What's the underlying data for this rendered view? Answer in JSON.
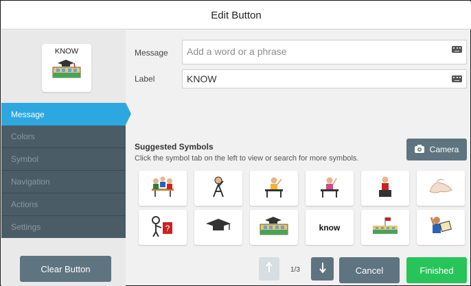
{
  "window": {
    "title": "Edit Button"
  },
  "preview": {
    "label": "KNOW",
    "icon": "graduation-school-icon"
  },
  "sidebar": {
    "items": [
      {
        "label": "Message",
        "active": true
      },
      {
        "label": "Colors",
        "active": false
      },
      {
        "label": "Symbol",
        "active": false
      },
      {
        "label": "Navigation",
        "active": false
      },
      {
        "label": "Actions",
        "active": false
      },
      {
        "label": "Settings",
        "active": false
      }
    ],
    "clear_label": "Clear Button"
  },
  "form": {
    "message_label": "Message",
    "message_value": "",
    "message_placeholder": "Add a word or a phrase",
    "label_label": "Label",
    "label_value": "KNOW"
  },
  "suggested": {
    "title": "Suggested Symbols",
    "subtitle": "Click the symbol tab on the left to view or search for more symbols.",
    "camera_label": "Camera",
    "symbols": [
      {
        "icon": "students-discussing-icon"
      },
      {
        "icon": "person-thinking-icon"
      },
      {
        "icon": "student-at-desk-icon"
      },
      {
        "icon": "student-at-desk-2-icon"
      },
      {
        "icon": "student-standing-icon"
      },
      {
        "icon": "hand-gesture-icon"
      },
      {
        "icon": "person-question-icon"
      },
      {
        "icon": "graduation-cap-icon"
      },
      {
        "icon": "school-graduation-icon"
      },
      {
        "text": "know"
      },
      {
        "icon": "school-building-icon"
      },
      {
        "icon": "person-with-paper-icon"
      }
    ]
  },
  "pagination": {
    "text": "1/3"
  },
  "footer": {
    "cancel_label": "Cancel",
    "finished_label": "Finished"
  },
  "colors": {
    "accent": "#2da7e0",
    "sidebar": "#4a5c66",
    "button": "#5e7480",
    "finished": "#27c45a"
  }
}
